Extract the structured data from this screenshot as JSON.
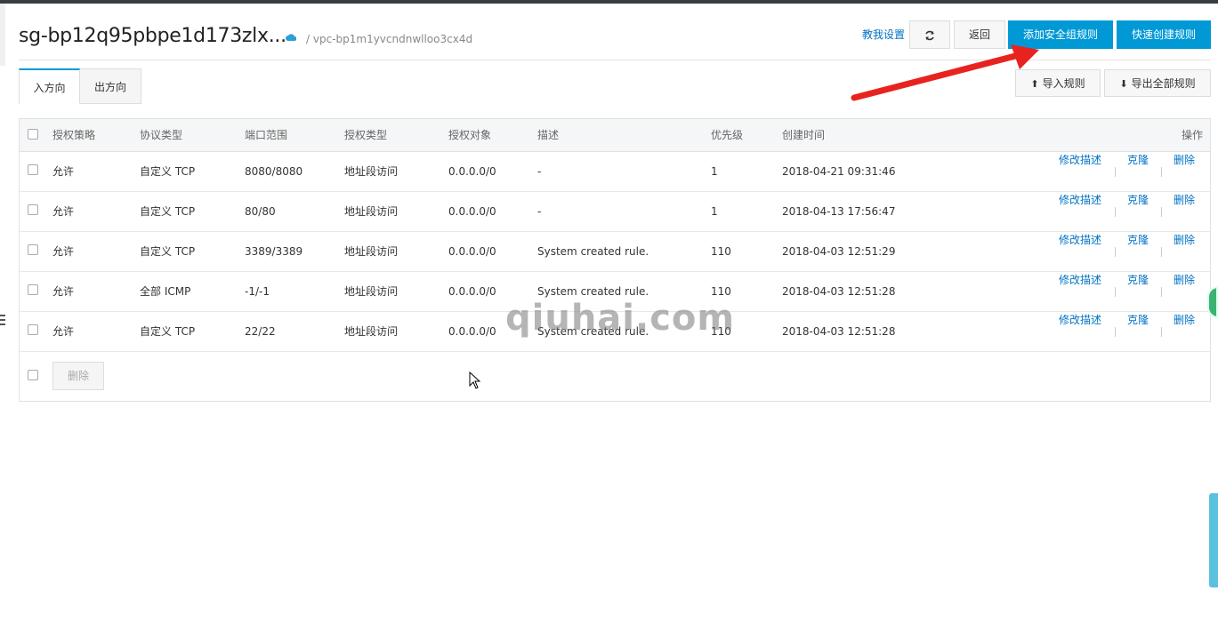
{
  "header": {
    "sg_id": "sg-bp12q95pbpe1d173zlx...",
    "vpc": "/ vpc-bp1m1yvcndnwlloo3cx4d",
    "help_link": "教我设置",
    "back_label": "返回",
    "add_rule_label": "添加安全组规则",
    "quick_create_label": "快速创建规则"
  },
  "tabs": [
    {
      "label": "入方向",
      "active": true
    },
    {
      "label": "出方向",
      "active": false
    }
  ],
  "toolbar": {
    "import_label": "导入规则",
    "export_label": "导出全部规则"
  },
  "table": {
    "columns": [
      "授权策略",
      "协议类型",
      "端口范围",
      "授权类型",
      "授权对象",
      "描述",
      "优先级",
      "创建时间",
      "操作"
    ],
    "rows": [
      {
        "policy": "允许",
        "protocol": "自定义 TCP",
        "port": "8080/8080",
        "auth_type": "地址段访问",
        "target": "0.0.0.0/0",
        "desc": "-",
        "priority": "1",
        "created": "2018-04-21 09:31:46"
      },
      {
        "policy": "允许",
        "protocol": "自定义 TCP",
        "port": "80/80",
        "auth_type": "地址段访问",
        "target": "0.0.0.0/0",
        "desc": "-",
        "priority": "1",
        "created": "2018-04-13 17:56:47"
      },
      {
        "policy": "允许",
        "protocol": "自定义 TCP",
        "port": "3389/3389",
        "auth_type": "地址段访问",
        "target": "0.0.0.0/0",
        "desc": "System created rule.",
        "priority": "110",
        "created": "2018-04-03 12:51:29"
      },
      {
        "policy": "允许",
        "protocol": "全部 ICMP",
        "port": "-1/-1",
        "auth_type": "地址段访问",
        "target": "0.0.0.0/0",
        "desc": "System created rule.",
        "priority": "110",
        "created": "2018-04-03 12:51:28"
      },
      {
        "policy": "允许",
        "protocol": "自定义 TCP",
        "port": "22/22",
        "auth_type": "地址段访问",
        "target": "0.0.0.0/0",
        "desc": "System created rule.",
        "priority": "110",
        "created": "2018-04-03 12:51:28"
      }
    ],
    "actions": {
      "edit": "修改描述",
      "clone": "克隆",
      "delete": "删除"
    },
    "bulk_delete_label": "删除"
  },
  "watermark": "qiuhai.com",
  "colors": {
    "primary": "#0099d6",
    "link": "#0072c6",
    "arrow": "#e8231f"
  }
}
